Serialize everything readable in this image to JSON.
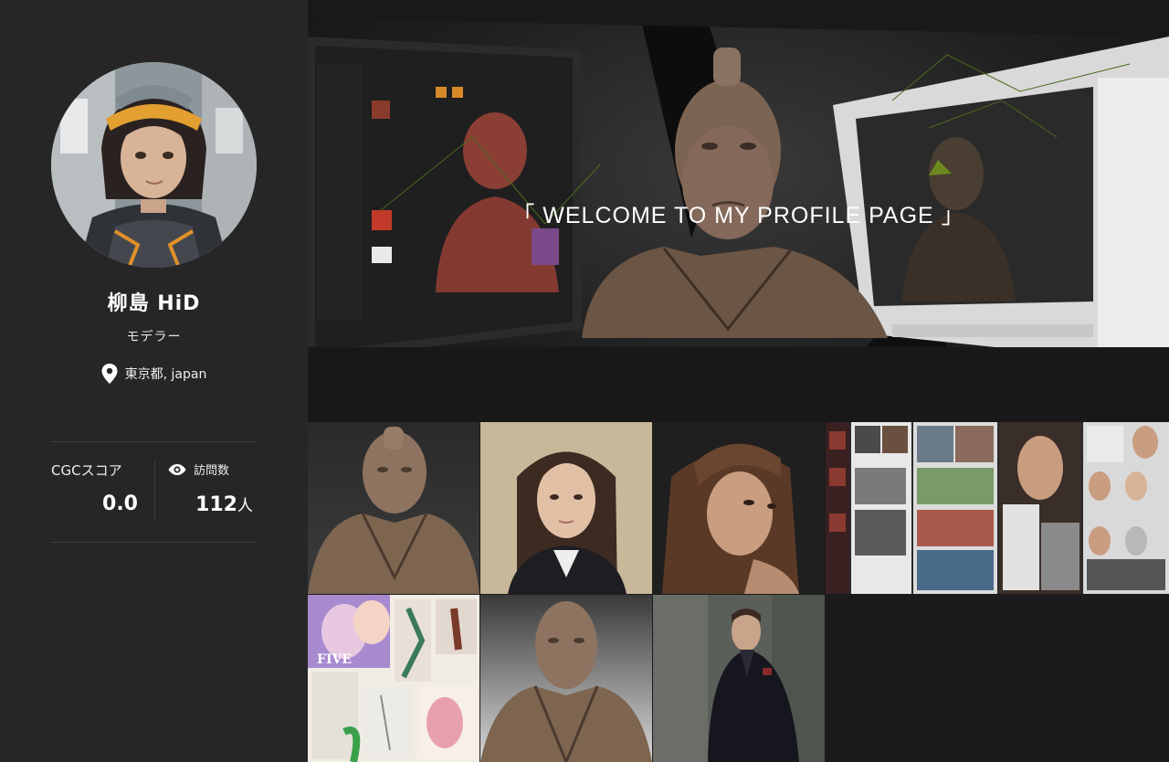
{
  "profile": {
    "name": "柳島 HiD",
    "role": "モデラー",
    "location": "東京都, japan"
  },
  "stats": {
    "score_label": "CGCスコア",
    "score_value": "0.0",
    "visits_label": "訪問数",
    "visits_value": "112",
    "visits_unit": "人"
  },
  "hero": {
    "title": "「 WELCOME TO MY PROFILE PAGE 」"
  },
  "icons": {
    "location": "location-pin-icon",
    "visits": "eye-icon"
  },
  "gallery": [
    {
      "subject": "samurai bust clay sculpt"
    },
    {
      "subject": "woman portrait in school uniform"
    },
    {
      "subject": "woman looking up portrait"
    },
    {
      "subject": "collage of zbrush works"
    },
    {
      "subject": "collage of character sketches"
    },
    {
      "subject": "samurai bust close-up"
    },
    {
      "subject": "man in dark suit outdoors"
    },
    {
      "subject": "anime character illustrations"
    },
    {
      "subject": "bald samurai bust"
    }
  ]
}
